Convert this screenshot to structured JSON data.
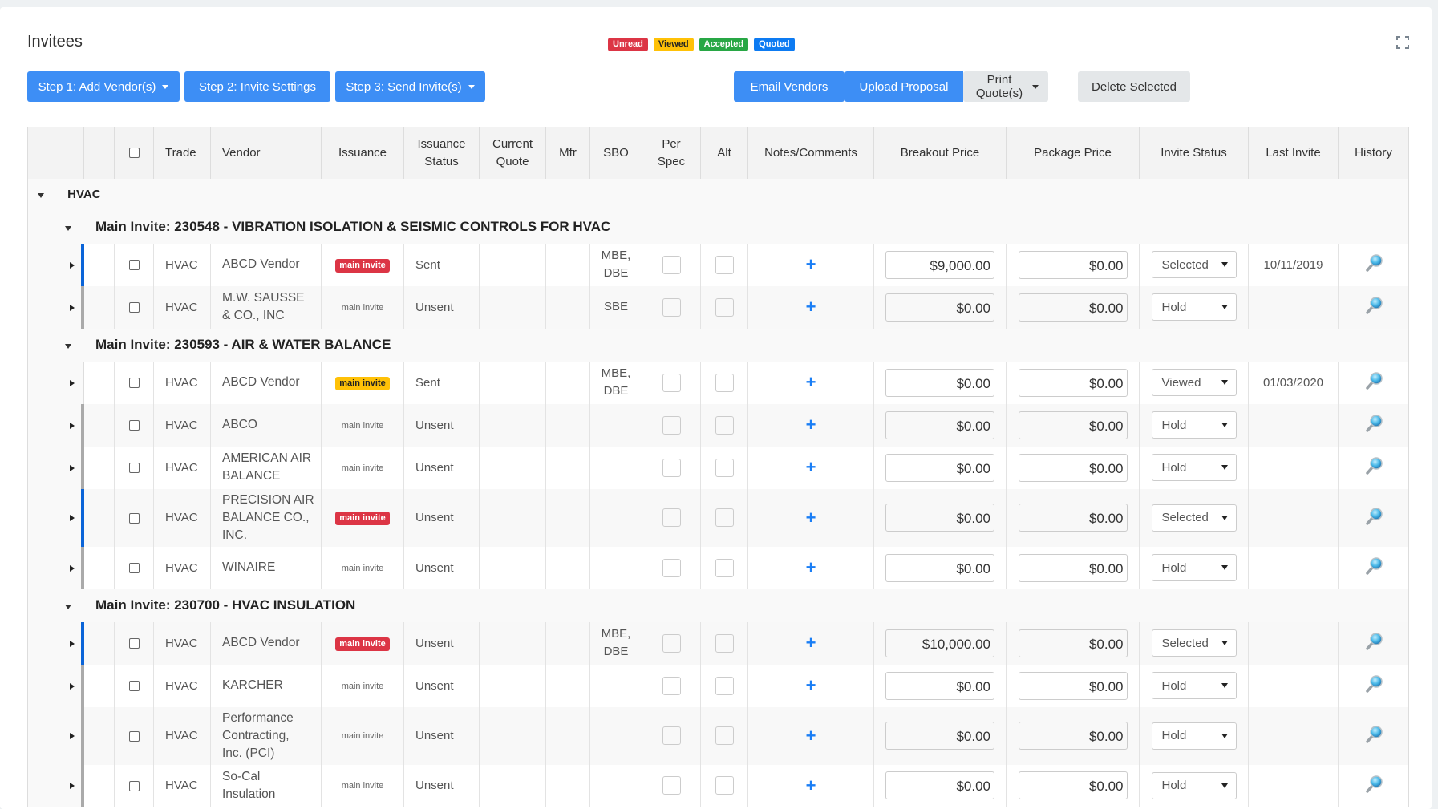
{
  "title": "Invitees",
  "legend": [
    {
      "label": "Unread",
      "bg": "#dc3545",
      "fg": "#ffffff"
    },
    {
      "label": "Viewed",
      "bg": "#ffc107",
      "fg": "#222222"
    },
    {
      "label": "Accepted",
      "bg": "#28a745",
      "fg": "#ffffff"
    },
    {
      "label": "Quoted",
      "bg": "#0d7bf2",
      "fg": "#ffffff"
    }
  ],
  "toolbar": {
    "step1": "Step 1: Add Vendor(s)",
    "step2": "Step 2: Invite Settings",
    "step3": "Step 3: Send Invite(s)",
    "email": "Email Vendors",
    "upload": "Upload Proposal",
    "print": "Print Quote(s)",
    "delete": "Delete Selected"
  },
  "columns": {
    "trade": "Trade",
    "vendor": "Vendor",
    "issuance": "Issuance",
    "issuance_status_1": "Issuance",
    "issuance_status_2": "Status",
    "current_quote_1": "Current",
    "current_quote_2": "Quote",
    "mfr": "Mfr",
    "sbo": "SBO",
    "per_spec_1": "Per",
    "per_spec_2": "Spec",
    "alt": "Alt",
    "notes": "Notes/Comments",
    "breakout": "Breakout Price",
    "package": "Package Price",
    "invite_status": "Invite Status",
    "last_invite": "Last Invite",
    "history": "History"
  },
  "trade_group": "HVAC",
  "groups": [
    {
      "label": "Main Invite: 230548 - VIBRATION ISOLATION & SEISMIC CONTROLS FOR HVAC",
      "rows": [
        {
          "trade": "HVAC",
          "vendor": [
            "ABCD Vendor"
          ],
          "issuance": "main invite",
          "badge": "red",
          "status": "Sent",
          "sbo": [
            "MBE,",
            "DBE"
          ],
          "breakout": "$9,000.00",
          "package": "$0.00",
          "invite_status": "Selected",
          "last_invite": "10/11/2019",
          "accent": "blue",
          "stripe": "white"
        },
        {
          "trade": "HVAC",
          "vendor": [
            "M.W. SAUSSE",
            "& CO., INC"
          ],
          "issuance": "main invite",
          "badge": "plain",
          "status": "Unsent",
          "sbo": [
            "SBE"
          ],
          "breakout": "$0.00",
          "package": "$0.00",
          "invite_status": "Hold",
          "last_invite": "",
          "accent": "grey",
          "stripe": "grey"
        }
      ]
    },
    {
      "label": "Main Invite: 230593 - AIR & WATER BALANCE",
      "rows": [
        {
          "trade": "HVAC",
          "vendor": [
            "ABCD Vendor"
          ],
          "issuance": "main invite",
          "badge": "yellow",
          "status": "Sent",
          "sbo": [
            "MBE,",
            "DBE"
          ],
          "breakout": "$0.00",
          "package": "$0.00",
          "invite_status": "Viewed",
          "last_invite": "01/03/2020",
          "accent": "none",
          "stripe": "white"
        },
        {
          "trade": "HVAC",
          "vendor": [
            "ABCO"
          ],
          "issuance": "main invite",
          "badge": "plain",
          "status": "Unsent",
          "sbo": [],
          "breakout": "$0.00",
          "package": "$0.00",
          "invite_status": "Hold",
          "last_invite": "",
          "accent": "grey",
          "stripe": "grey"
        },
        {
          "trade": "HVAC",
          "vendor": [
            "AMERICAN AIR",
            "BALANCE"
          ],
          "issuance": "main invite",
          "badge": "plain",
          "status": "Unsent",
          "sbo": [],
          "breakout": "$0.00",
          "package": "$0.00",
          "invite_status": "Hold",
          "last_invite": "",
          "accent": "grey",
          "stripe": "white"
        },
        {
          "trade": "HVAC",
          "vendor": [
            "PRECISION AIR",
            "BALANCE CO.,",
            "INC."
          ],
          "issuance": "main invite",
          "badge": "red",
          "status": "Unsent",
          "sbo": [],
          "breakout": "$0.00",
          "package": "$0.00",
          "invite_status": "Selected",
          "last_invite": "",
          "accent": "blue",
          "stripe": "grey"
        },
        {
          "trade": "HVAC",
          "vendor": [
            "WINAIRE"
          ],
          "issuance": "main invite",
          "badge": "plain",
          "status": "Unsent",
          "sbo": [],
          "breakout": "$0.00",
          "package": "$0.00",
          "invite_status": "Hold",
          "last_invite": "",
          "accent": "grey",
          "stripe": "white"
        }
      ]
    },
    {
      "label": "Main Invite: 230700 - HVAC INSULATION",
      "rows": [
        {
          "trade": "HVAC",
          "vendor": [
            "ABCD Vendor"
          ],
          "issuance": "main invite",
          "badge": "red",
          "status": "Unsent",
          "sbo": [
            "MBE,",
            "DBE"
          ],
          "breakout": "$10,000.00",
          "package": "$0.00",
          "invite_status": "Selected",
          "last_invite": "",
          "accent": "blue",
          "stripe": "grey"
        },
        {
          "trade": "HVAC",
          "vendor": [
            "KARCHER"
          ],
          "issuance": "main invite",
          "badge": "plain",
          "status": "Unsent",
          "sbo": [],
          "breakout": "$0.00",
          "package": "$0.00",
          "invite_status": "Hold",
          "last_invite": "",
          "accent": "grey",
          "stripe": "white"
        },
        {
          "trade": "HVAC",
          "vendor": [
            "Performance",
            "Contracting,",
            "Inc. (PCI)"
          ],
          "issuance": "main invite",
          "badge": "plain",
          "status": "Unsent",
          "sbo": [],
          "breakout": "$0.00",
          "package": "$0.00",
          "invite_status": "Hold",
          "last_invite": "",
          "accent": "grey",
          "stripe": "grey"
        },
        {
          "trade": "HVAC",
          "vendor": [
            "So-Cal",
            "Insulation"
          ],
          "issuance": "main invite",
          "badge": "plain",
          "status": "Unsent",
          "sbo": [],
          "breakout": "$0.00",
          "package": "$0.00",
          "invite_status": "Hold",
          "last_invite": "",
          "accent": "grey",
          "stripe": "white"
        }
      ]
    }
  ]
}
